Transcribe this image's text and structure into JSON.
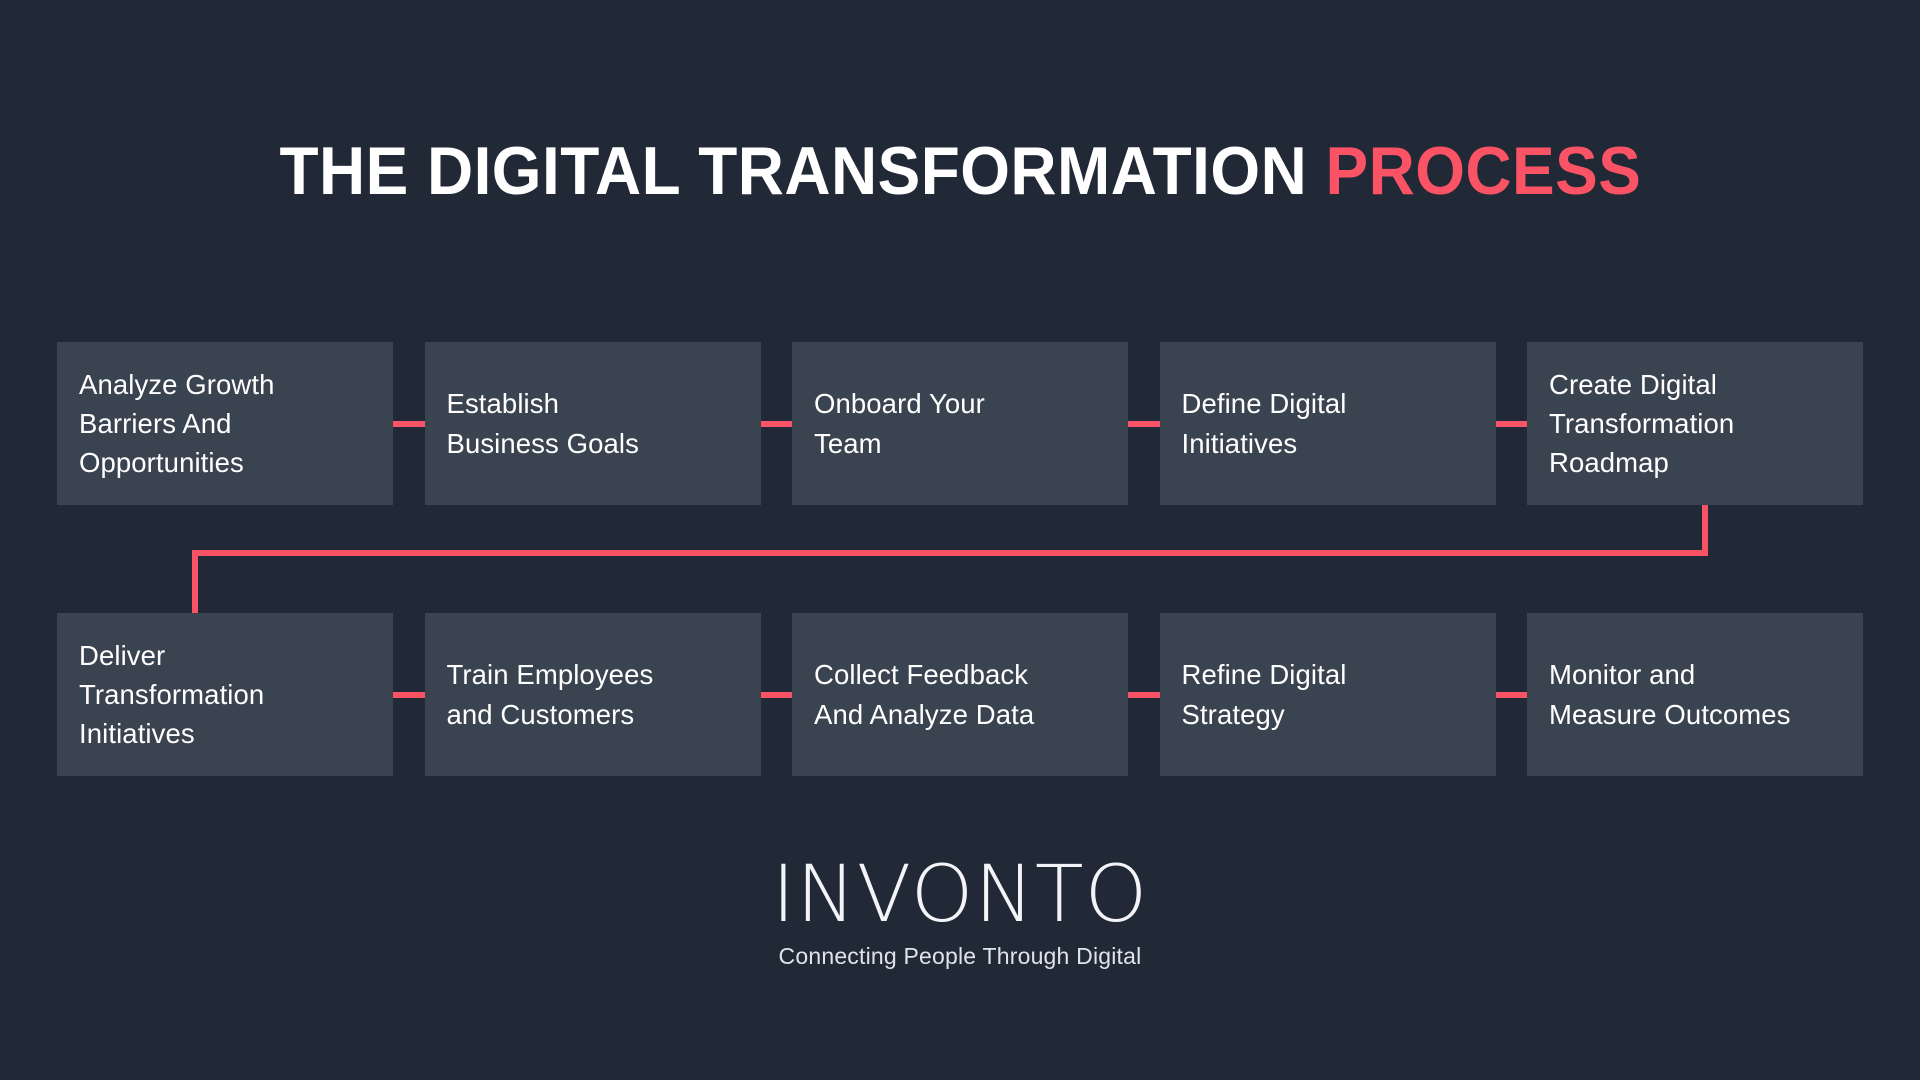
{
  "background_color": "#212836",
  "accent_color": "#fa5365",
  "node_color": "#3a4350",
  "text_color": "#ffffff",
  "header": {
    "title_main": "THE DIGITAL TRANSFORMATION",
    "title_accent": "PROCESS"
  },
  "flow": {
    "row1": [
      {
        "label": "Analyze Growth\nBarriers And\nOpportunities"
      },
      {
        "label": "Establish\nBusiness Goals"
      },
      {
        "label": "Onboard Your\nTeam"
      },
      {
        "label": "Define Digital\nInitiatives"
      },
      {
        "label": "Create Digital\nTransformation\nRoadmap"
      }
    ],
    "row2": [
      {
        "label": "Deliver\nTransformation\nInitiatives"
      },
      {
        "label": "Train Employees\nand  Customers"
      },
      {
        "label": "Collect Feedback\nAnd Analyze Data"
      },
      {
        "label": "Refine Digital\nStrategy"
      },
      {
        "label": "Monitor and\nMeasure Outcomes"
      }
    ]
  },
  "logo": {
    "name": "INVONTO",
    "tagline": "Connecting People Through Digital"
  }
}
